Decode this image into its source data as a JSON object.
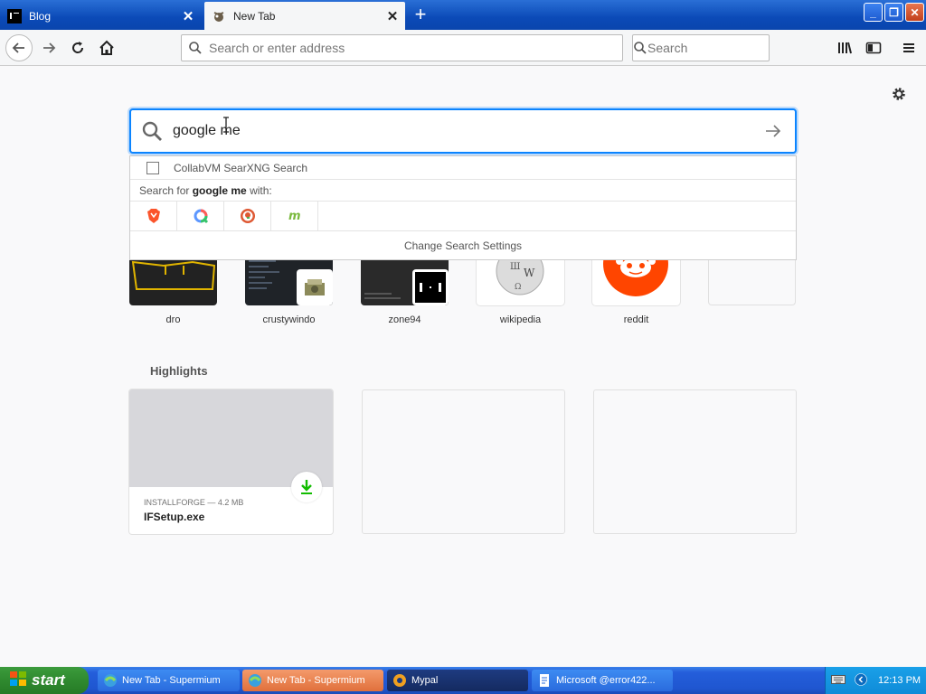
{
  "browser": {
    "tabs": [
      {
        "title": "Blog"
      },
      {
        "title": "New Tab"
      }
    ],
    "url_placeholder": "Search or enter address",
    "search_placeholder": "Search"
  },
  "page": {
    "search_query": "google me",
    "suggestions": {
      "first": "CollabVM SearXNG Search",
      "search_for_prefix": "Search for ",
      "search_for_query": "google me",
      "search_for_suffix": " with:",
      "engines": [
        "brave-icon",
        "qwant-icon",
        "duckduckgo-icon",
        "mojeek-icon"
      ],
      "change_settings": "Change Search Settings"
    },
    "top_sites": [
      {
        "label": "dro"
      },
      {
        "label": "crustywindo"
      },
      {
        "label": "zone94"
      },
      {
        "label": "wikipedia"
      },
      {
        "label": "reddit"
      },
      {
        "label": ""
      }
    ],
    "highlights": {
      "title": "Highlights",
      "card": {
        "meta": "INSTALLFORGE — 4.2 MB",
        "name": "IFSetup.exe"
      }
    }
  },
  "taskbar": {
    "start": "start",
    "items": [
      {
        "label": "New Tab - Supermium"
      },
      {
        "label": "New Tab - Supermium"
      },
      {
        "label": "Mypal"
      },
      {
        "label": "Microsoft @error422..."
      }
    ],
    "clock": "12:13 PM"
  },
  "colors": {
    "accent": "#0a84ff",
    "reddit": "#ff4500",
    "download": "#12bc00"
  }
}
